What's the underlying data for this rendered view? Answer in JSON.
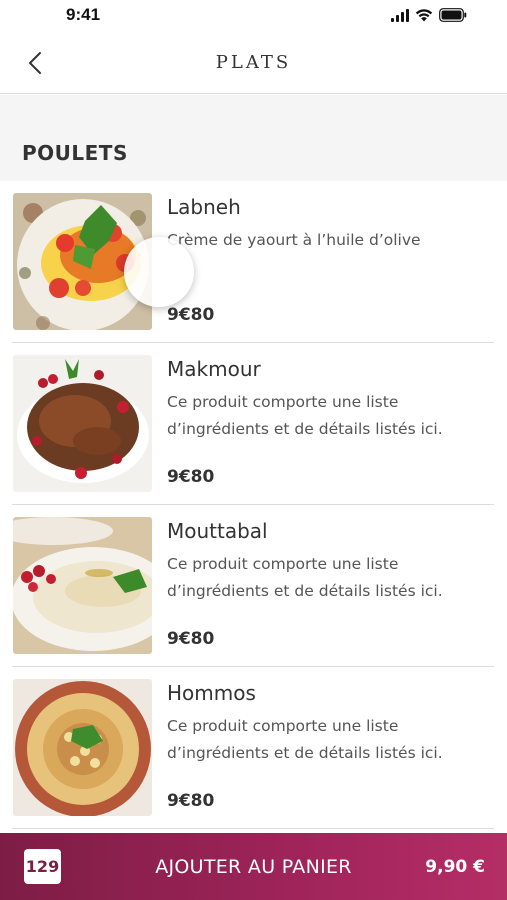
{
  "status_bar": {
    "time": "9:41",
    "icons": [
      "signal-icon",
      "wifi-icon",
      "battery-icon"
    ]
  },
  "nav": {
    "title": "PLATS",
    "back_icon": "chevron-left-icon"
  },
  "section": {
    "title": "POULETS"
  },
  "products": [
    {
      "name": "Labneh",
      "description": "Crème de yaourt à l’huile d’olive",
      "price": "9€80"
    },
    {
      "name": "Makmour",
      "description": "Ce produit comporte une liste d’ingrédients et de détails listés ici.",
      "price": "9€80"
    },
    {
      "name": "Mouttabal",
      "description": "Ce produit comporte une liste d’ingrédients et de détails listés ici.",
      "price": "9€80"
    },
    {
      "name": "Hommos",
      "description": "Ce produit comporte une liste d’ingrédients et de détails listés ici.",
      "price": "9€80"
    }
  ],
  "cart": {
    "count": "129",
    "label": "AJOUTER AU PANIER",
    "total": "9,90 €"
  },
  "colors": {
    "cart_gradient_start": "#7d1d45",
    "cart_gradient_end": "#b52e66",
    "section_background": "#f5f5f5"
  }
}
